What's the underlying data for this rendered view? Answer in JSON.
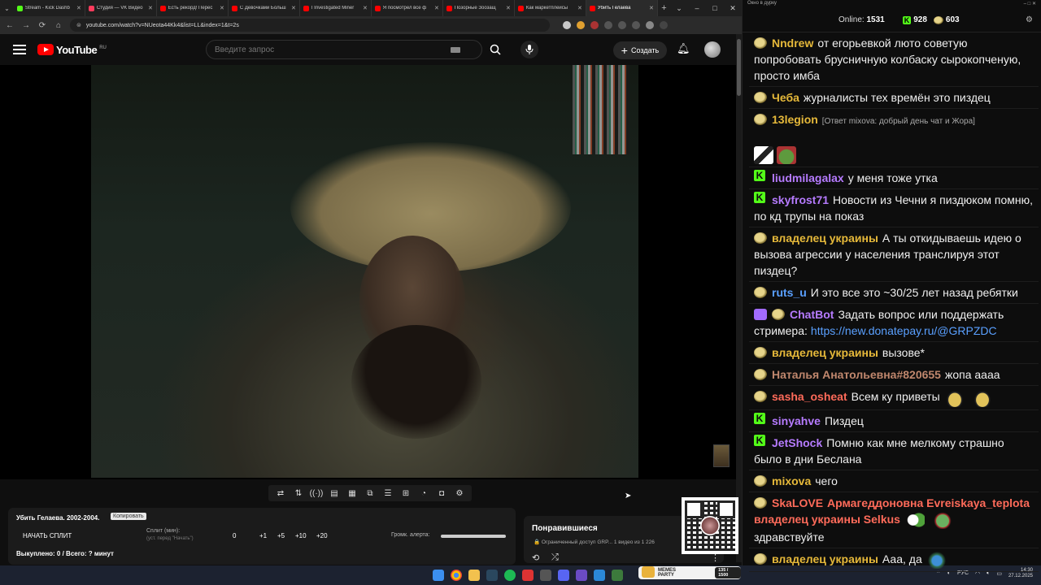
{
  "browser": {
    "tabs": [
      {
        "title": "Stream - Kick Dashb",
        "color": "#53fc18"
      },
      {
        "title": "Студия — VK Видео",
        "color": "#ff3b5c"
      },
      {
        "title": "Есть рекорд! Перес",
        "color": "#ff0000"
      },
      {
        "title": "С Девочками Больш",
        "color": "#ff0000"
      },
      {
        "title": "I Investigated Miner",
        "color": "#ff0000"
      },
      {
        "title": "Я посмотрел все ф",
        "color": "#ff0000"
      },
      {
        "title": "Позорные Зоозащ",
        "color": "#ff0000"
      },
      {
        "title": "Как маркетплейсы",
        "color": "#ff0000"
      },
      {
        "title": "Убить Гелаева",
        "color": "#ff0000"
      }
    ],
    "url": "youtube.com/watch?v=NUeota44Kk4&list=LL&index=1&t=2s",
    "win_controls": [
      "⌄",
      "–",
      "□",
      "✕"
    ]
  },
  "youtube": {
    "logo_text": "YouTube",
    "region": "RU",
    "search_placeholder": "Введите запрос",
    "create_label": "Создать"
  },
  "split_panel": {
    "title": "Убить Гелаева. 2002-2004.",
    "badge": "Копировать",
    "start_label": "НАЧАТЬ СПЛИТ",
    "split_label": "Сплит (мин):",
    "split_sub": "(уст. перед \"Начать\")",
    "values": [
      "0",
      "+1",
      "+5",
      "+10",
      "+20"
    ],
    "alert_label": "Громк. алерта:",
    "bought": "Выкуплено: 0 / Всего: ? минут"
  },
  "liked_panel": {
    "title": "Понравившиеся",
    "meta": "🔒 Ограниченный доступ  GRP...  1 видео из 1 226"
  },
  "memes_widget": {
    "brand": "MEMES PARTY",
    "counter": "135 / 1500"
  },
  "taskbar": {
    "lang": "РУС",
    "time": "14:30",
    "date": "27.12.2025"
  },
  "chat": {
    "top_title": "Окно в дурку",
    "online_label": "Online:",
    "online_count": "1531",
    "kick_count": "928",
    "other_count": "603",
    "messages": [
      {
        "icon": "frog",
        "nick": "Nndrew",
        "color": "#e6b93a",
        "text": "от егорьевкой люто советую попробовать брусничную колбаску сырокопченую, просто имба"
      },
      {
        "icon": "frog",
        "nick": "Чеба",
        "color": "#e6b93a",
        "text": "журналисты тех времён это пиздец"
      },
      {
        "icon": "frog",
        "nick": "13legion",
        "color": "#e6b93a",
        "text": "",
        "reply": "[Ответ mixova: добрый день чат и Жора]"
      },
      {
        "icon": "kick",
        "nick": "liudmilagalax",
        "color": "#b67bff",
        "text": "у меня тоже утка"
      },
      {
        "icon": "kick",
        "nick": "skyfrost71",
        "color": "#b67bff",
        "text": "Новости из Чечни я пиздюком помню, по кд трупы на показ"
      },
      {
        "icon": "frog",
        "nick": "владелец украины",
        "color": "#e6b93a",
        "text": "А ты откидываешь идею о вызова агрессии у населения транслируя этот пиздец?"
      },
      {
        "icon": "frog",
        "nick": "ruts_u",
        "color": "#5aa0ff",
        "text": "И это все это ~30/25 лет назад ребятки"
      },
      {
        "icon": "bot",
        "nick": "ChatBot",
        "color": "#b67bff",
        "text": "Задать вопрос или поддержать стримера:",
        "link": "https://new.donatepay.ru/@GRPZDC"
      },
      {
        "icon": "frog",
        "nick": "владелец украины",
        "color": "#e6b93a",
        "text": "вызове*"
      },
      {
        "icon": "frog",
        "nick": "Наталья Анатольевна#820655",
        "color": "#c0876d",
        "text": "жопа аааа"
      },
      {
        "icon": "frog",
        "nick": "sasha_osheat",
        "color": "#ff6b5a",
        "text": "Всем ку приветы"
      },
      {
        "icon": "kick",
        "nick": "sinyahve",
        "color": "#b67bff",
        "text": "Пиздец"
      },
      {
        "icon": "kick",
        "nick": "JetShock",
        "color": "#b67bff",
        "text": "Помню как мне мелкому страшно было в дни Беслана"
      },
      {
        "icon": "frog",
        "nick": "mixova",
        "color": "#e6b93a",
        "text": "чего"
      },
      {
        "icon": "frog",
        "nick": "SkaLOVE",
        "color": "#ff6b5a",
        "text": "",
        "mentions": "Армагеддоновна Evreiskaya_teplota владелец украины Selkus",
        "after": "здравствуйте"
      },
      {
        "icon": "frog",
        "nick": "владелец украины",
        "color": "#e6b93a",
        "text": "Ааа, да"
      }
    ]
  }
}
